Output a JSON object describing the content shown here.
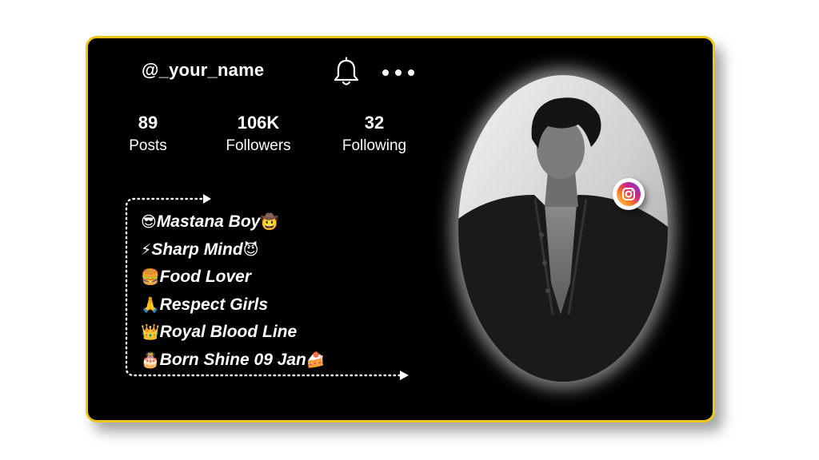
{
  "profile": {
    "username": "@_your_name"
  },
  "stats": {
    "posts": {
      "value": "89",
      "label": "Posts"
    },
    "followers": {
      "value": "106K",
      "label": "Followers"
    },
    "following": {
      "value": "32",
      "label": "Following"
    }
  },
  "bio": [
    {
      "emoji_start": "😎",
      "text": "Mastana Boy",
      "emoji_end": "🤠"
    },
    {
      "emoji_start": "⚡",
      "text": "Sharp Mind",
      "emoji_end": "😈"
    },
    {
      "emoji_start": "🍔",
      "text": "Food Lover",
      "emoji_end": ""
    },
    {
      "emoji_start": "🙏",
      "text": "Respect Girls",
      "emoji_end": ""
    },
    {
      "emoji_start": "👑",
      "text": "Royal Blood Line",
      "emoji_end": ""
    },
    {
      "emoji_start": "🎂",
      "text": "Born Shine 09 Jan",
      "emoji_end": "🍰"
    }
  ],
  "icons": {
    "notification": "bell-icon",
    "more": "more-dots-icon",
    "instagram": "instagram-icon"
  },
  "colors": {
    "card_background": "#000000",
    "card_border": "#f0c419",
    "text": "#ffffff"
  }
}
